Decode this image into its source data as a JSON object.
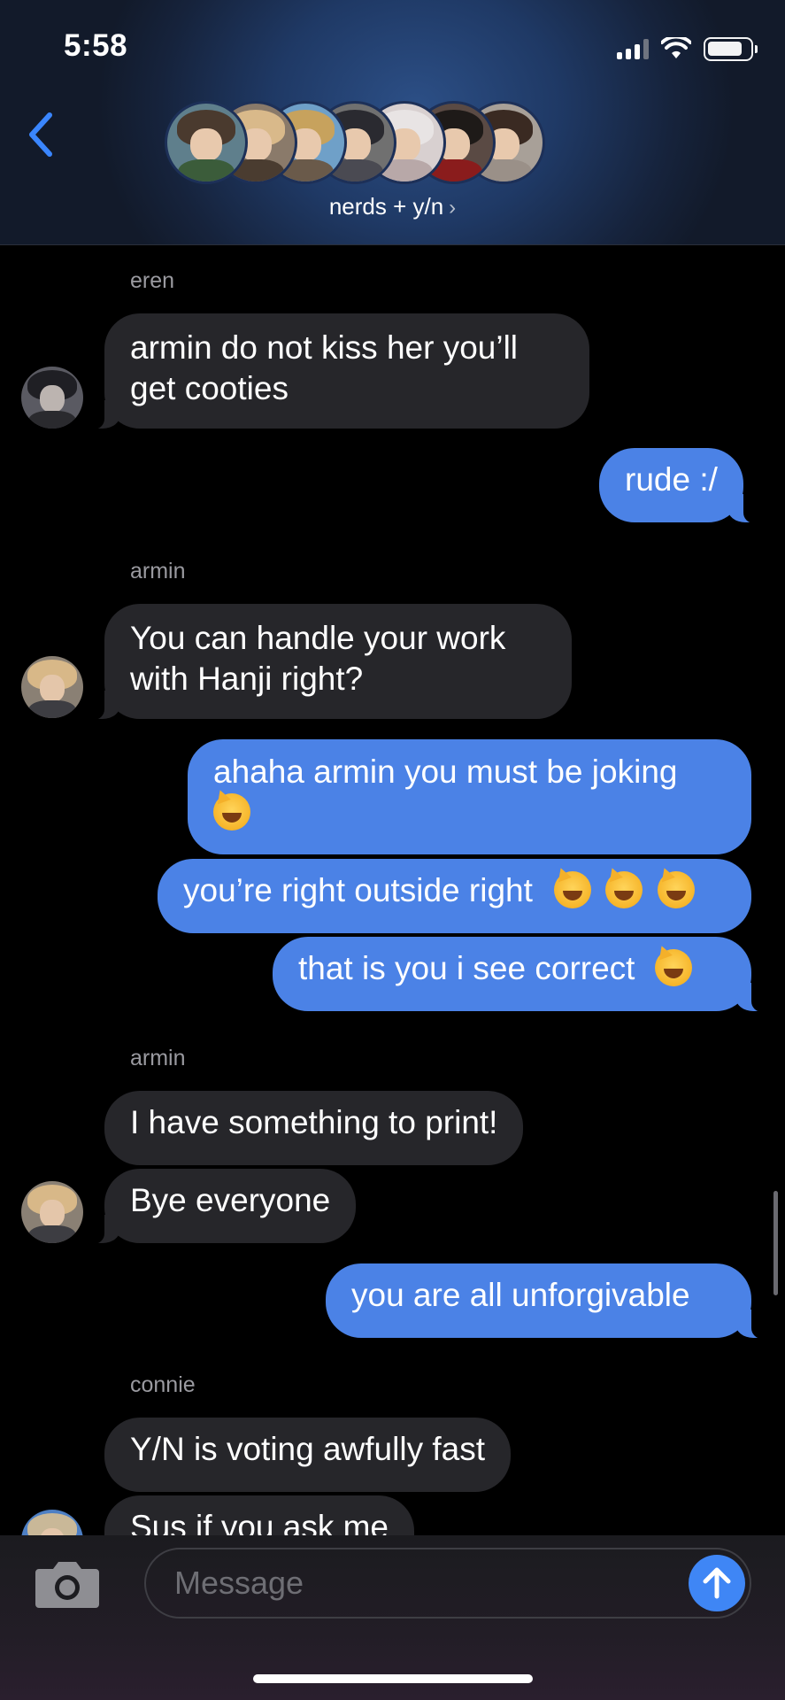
{
  "status_bar": {
    "time": "5:58"
  },
  "header": {
    "group_name": "nerds + y/n",
    "avatars": [
      {
        "name": "group-avatar-1",
        "hair": "#4a3a2e",
        "body": "#3b5c3a",
        "bg": "#5f7f8c"
      },
      {
        "name": "group-avatar-2",
        "hair": "#d9b98a",
        "body": "#4a3c30",
        "bg": "#8a7a6a"
      },
      {
        "name": "group-avatar-3",
        "hair": "#c7a25d",
        "body": "#6a5a4a",
        "bg": "#6fa0c8"
      },
      {
        "name": "group-avatar-4",
        "hair": "#2a2a30",
        "body": "#4a4a52",
        "bg": "#707070"
      },
      {
        "name": "group-avatar-5",
        "hair": "#e8e4e4",
        "body": "#b8a8a8",
        "bg": "#d8d0d0"
      },
      {
        "name": "group-avatar-6",
        "hair": "#1e1a18",
        "body": "#8a1c1c",
        "bg": "#5a4a44"
      },
      {
        "name": "group-avatar-7",
        "hair": "#3a2a22",
        "body": "#9a9088",
        "bg": "#a8a098"
      }
    ]
  },
  "messages": {
    "sender_eren": "eren",
    "m1": "armin do not kiss her you’ll",
    "m1b": "get cooties",
    "m2": "rude :/",
    "sender_armin_1": "armin",
    "m3": "You can handle your work",
    "m3b": "with Hanji right?",
    "m4": "ahaha armin you must be joking",
    "m5": "you’re right outside right",
    "m6": "that is you i see correct",
    "sender_armin_2": "armin",
    "m7": "I have something to print!",
    "m8": "Bye everyone",
    "m9": "you are all unforgivable",
    "sender_connie": "connie",
    "m10": "Y/N is voting awfully fast",
    "m11": "Sus if you ask me"
  },
  "composer": {
    "placeholder": "Message"
  },
  "colors": {
    "outgoing_bubble": "#4b82e6",
    "incoming_bubble": "#26262a",
    "accent": "#3f86f5"
  }
}
